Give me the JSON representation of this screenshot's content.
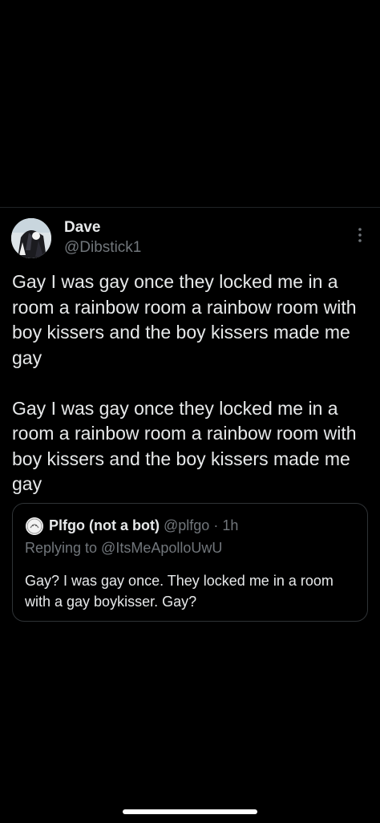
{
  "tweet": {
    "author_name": "Dave",
    "author_handle": "@Dibstick1",
    "paragraphs": [
      "Gay I was gay once they locked me in a room a rainbow room a rainbow room with boy kissers and the boy kissers made me gay",
      "Gay I was gay once they locked me in a room a rainbow room a rainbow room with boy kissers and the boy kissers made me gay"
    ]
  },
  "quote": {
    "author_name": "Plfgo (not a bot)",
    "author_handle": "@plfgo",
    "separator": "·",
    "time": "1h",
    "replying_to": "Replying to @ItsMeApolloUwU",
    "text": "Gay? I was gay once. They locked me in a room with a gay boykisser. Gay?"
  },
  "icons": {
    "more": "more-vertical-icon",
    "avatar": "avatar-image",
    "quote_avatar": "quote-avatar-image"
  },
  "colors": {
    "background": "#000000",
    "primary_text": "#e7e9ea",
    "secondary_text": "#71767b",
    "border": "#2f3336"
  }
}
